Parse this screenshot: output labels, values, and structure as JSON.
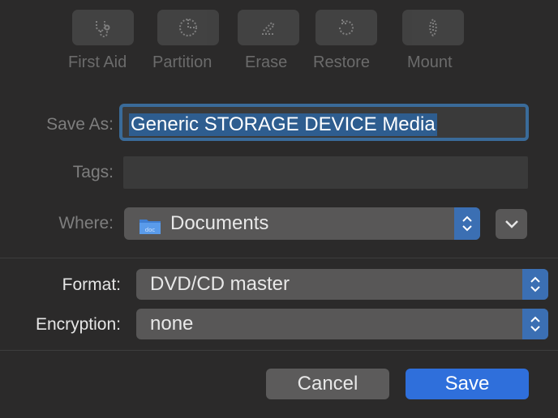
{
  "toolbar": {
    "items": [
      {
        "label": "First Aid",
        "icon": "stethoscope-icon"
      },
      {
        "label": "Partition",
        "icon": "pie-chart-icon"
      },
      {
        "label": "Erase",
        "icon": "erase-icon"
      },
      {
        "label": "Restore",
        "icon": "restore-icon"
      },
      {
        "label": "Mount",
        "icon": "mount-icon"
      }
    ]
  },
  "form": {
    "save_as_label": "Save As:",
    "save_as_value": "Generic STORAGE DEVICE Media",
    "tags_label": "Tags:",
    "tags_value": "",
    "where_label": "Where:",
    "where_value": "Documents",
    "where_icon": "folder-icon"
  },
  "options": {
    "format_label": "Format:",
    "format_value": "DVD/CD master",
    "encryption_label": "Encryption:",
    "encryption_value": "none"
  },
  "buttons": {
    "cancel_label": "Cancel",
    "save_label": "Save"
  },
  "colors": {
    "accent": "#2f6fdb",
    "background": "#2b2a2a",
    "selection": "#2e5d8f"
  }
}
